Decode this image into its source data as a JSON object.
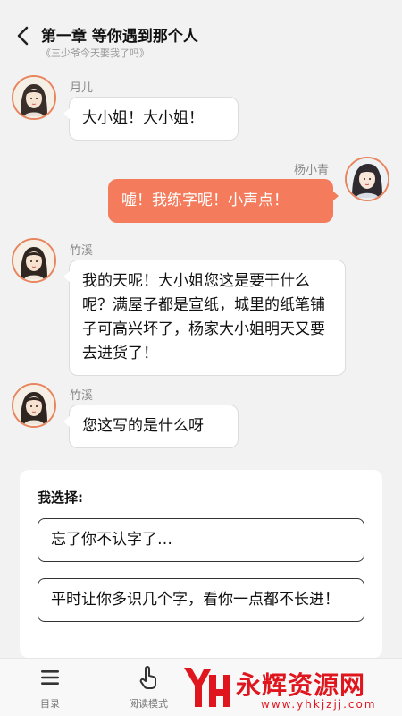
{
  "header": {
    "chapter_title": "第一章 等你遇到那个人",
    "book_title": "《三少爷今天娶我了吗》"
  },
  "messages": [
    {
      "speaker": "月儿",
      "text": "大小姐！大小姐！",
      "side": "left"
    },
    {
      "speaker": "杨小青",
      "text": "嘘！我练字呢！小声点！",
      "side": "right"
    },
    {
      "speaker": "竹溪",
      "text": "我的天呢！大小姐您这是要干什么呢？满屋子都是宣纸，城里的纸笔铺子可高兴坏了，杨家大小姐明天又要去进货了！",
      "side": "left"
    },
    {
      "speaker": "竹溪",
      "text": "您这写的是什么呀",
      "side": "left"
    }
  ],
  "choices": {
    "heading": "我选择:",
    "options": [
      "忘了你不认字了…",
      "平时让你多识几个字，看你一点都不长进！"
    ]
  },
  "bottom_nav": {
    "items": [
      {
        "label": "目录",
        "icon": "menu-icon"
      },
      {
        "label": "阅读模式",
        "icon": "hand-pointer-icon"
      }
    ]
  },
  "watermark": {
    "text": "永辉资源网",
    "url": "www.yhkjzjj.com"
  },
  "colors": {
    "accent": "#f47b5b",
    "avatar_border": "#e8855f",
    "watermark": "#e0161e"
  }
}
